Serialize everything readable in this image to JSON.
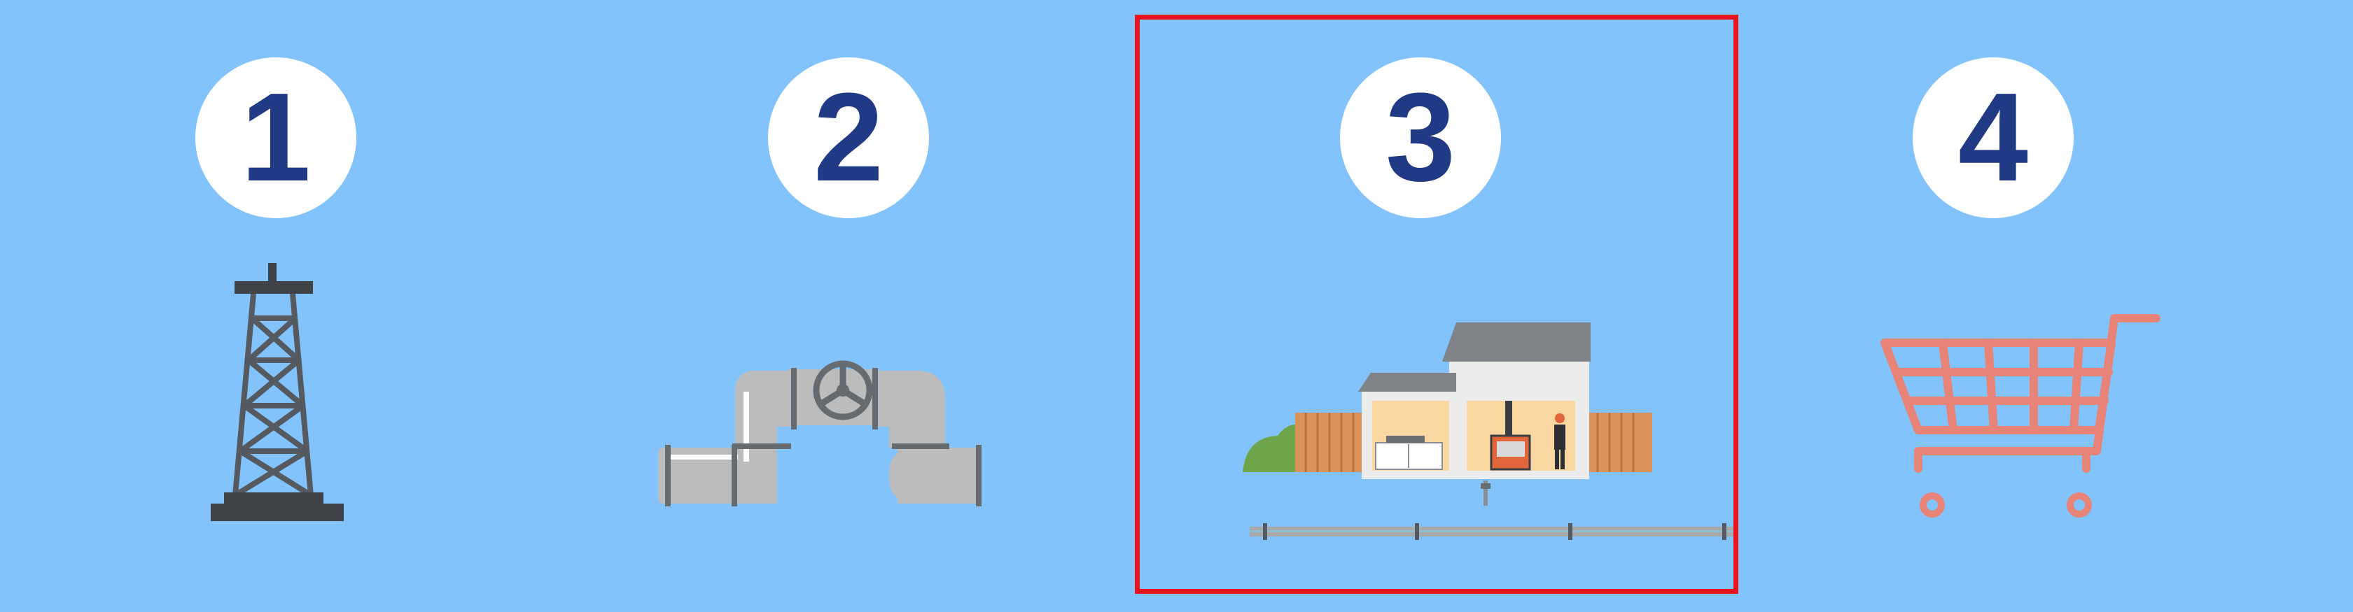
{
  "steps": [
    {
      "number": "1",
      "icon": "oil-derrick-icon"
    },
    {
      "number": "2",
      "icon": "pipeline-valve-icon"
    },
    {
      "number": "3",
      "icon": "house-icon",
      "highlighted": true
    },
    {
      "number": "4",
      "icon": "shopping-cart-icon"
    }
  ],
  "colors": {
    "background": "#82c3fb",
    "circle": "#ffffff",
    "number": "#203a85",
    "highlight_border": "#e6141c",
    "derrick": "#4b4f55",
    "pipe": "#bcbcbc",
    "cart": "#e88378"
  }
}
